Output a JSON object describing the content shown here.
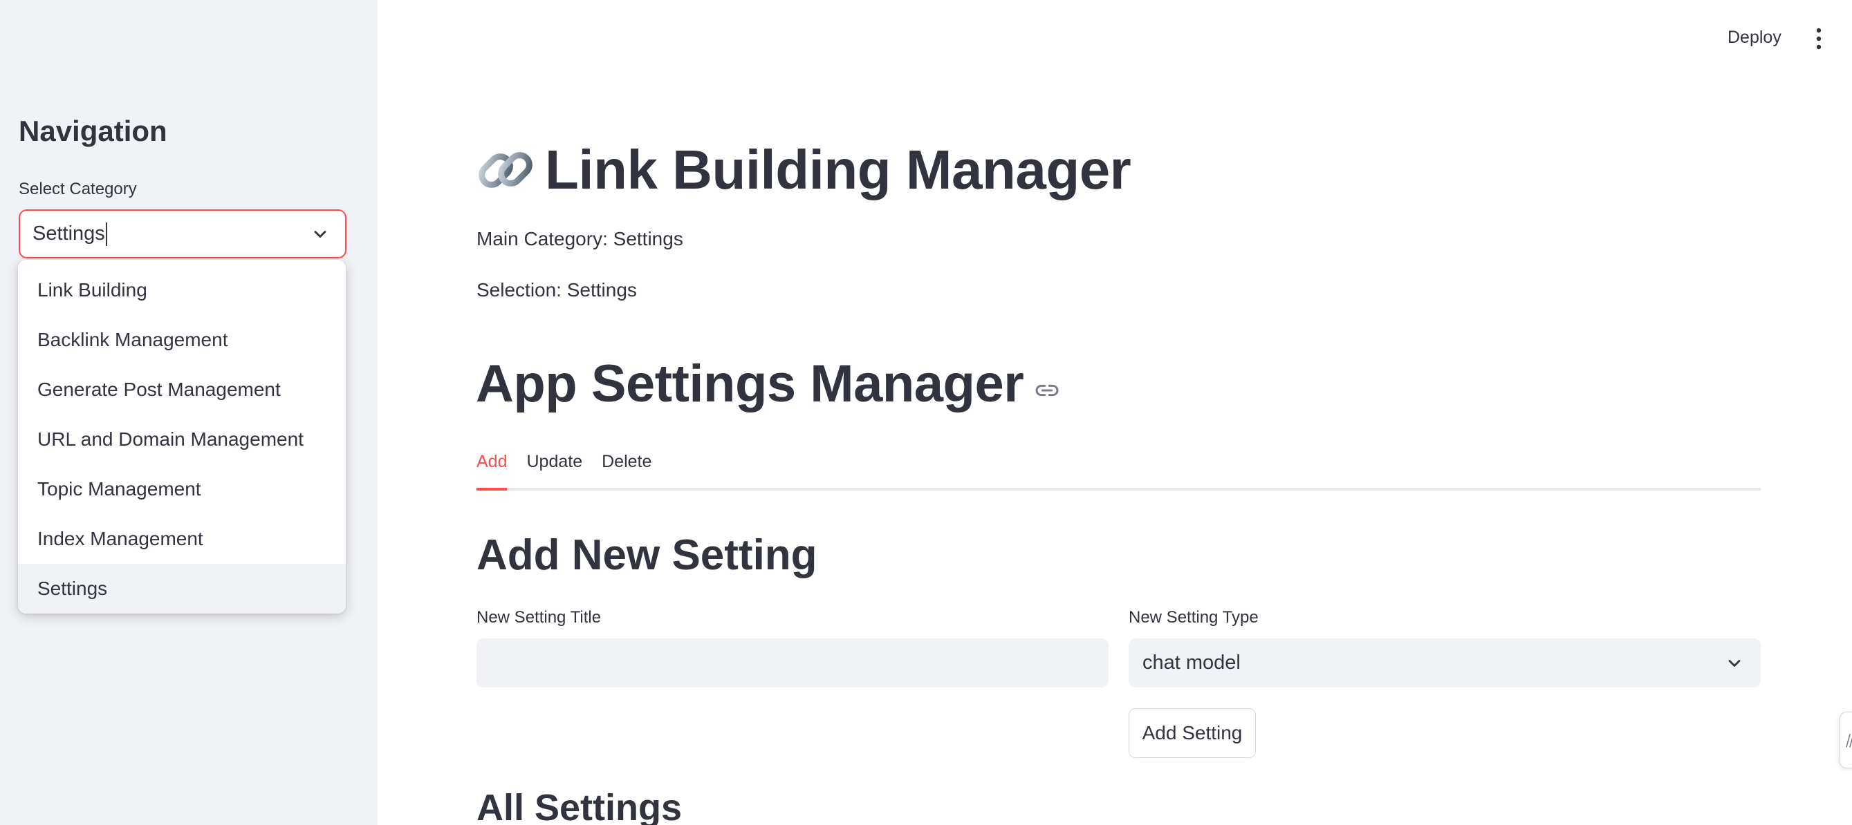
{
  "header": {
    "deploy_label": "Deploy",
    "menu_icon": "kebab-menu-icon"
  },
  "sidebar": {
    "title": "Navigation",
    "select_label": "Select Category",
    "select_value": "Settings",
    "dropdown_options": [
      "Link Building",
      "Backlink Management",
      "Generate Post Management",
      "URL and Domain Management",
      "Topic Management",
      "Index Management",
      "Settings"
    ],
    "selected_option": "Settings"
  },
  "main": {
    "title_icon": "link-emoji-icon",
    "title": "Link Building Manager",
    "main_category_text": "Main Category: Settings",
    "selection_text": "Selection: Settings",
    "section_title": "App Settings Manager",
    "tabs": [
      {
        "label": "Add",
        "active": true
      },
      {
        "label": "Update",
        "active": false
      },
      {
        "label": "Delete",
        "active": false
      }
    ],
    "form": {
      "heading": "Add New Setting",
      "title_label": "New Setting Title",
      "title_value": "",
      "type_label": "New Setting Type",
      "type_value": "chat model",
      "submit_label": "Add Setting"
    },
    "all_settings_heading": "All Settings"
  },
  "colors": {
    "accent": "#ff4b4b",
    "sidebar_bg": "#f0f2f6",
    "text": "#31333f",
    "input_bg": "#f0f2f6"
  }
}
